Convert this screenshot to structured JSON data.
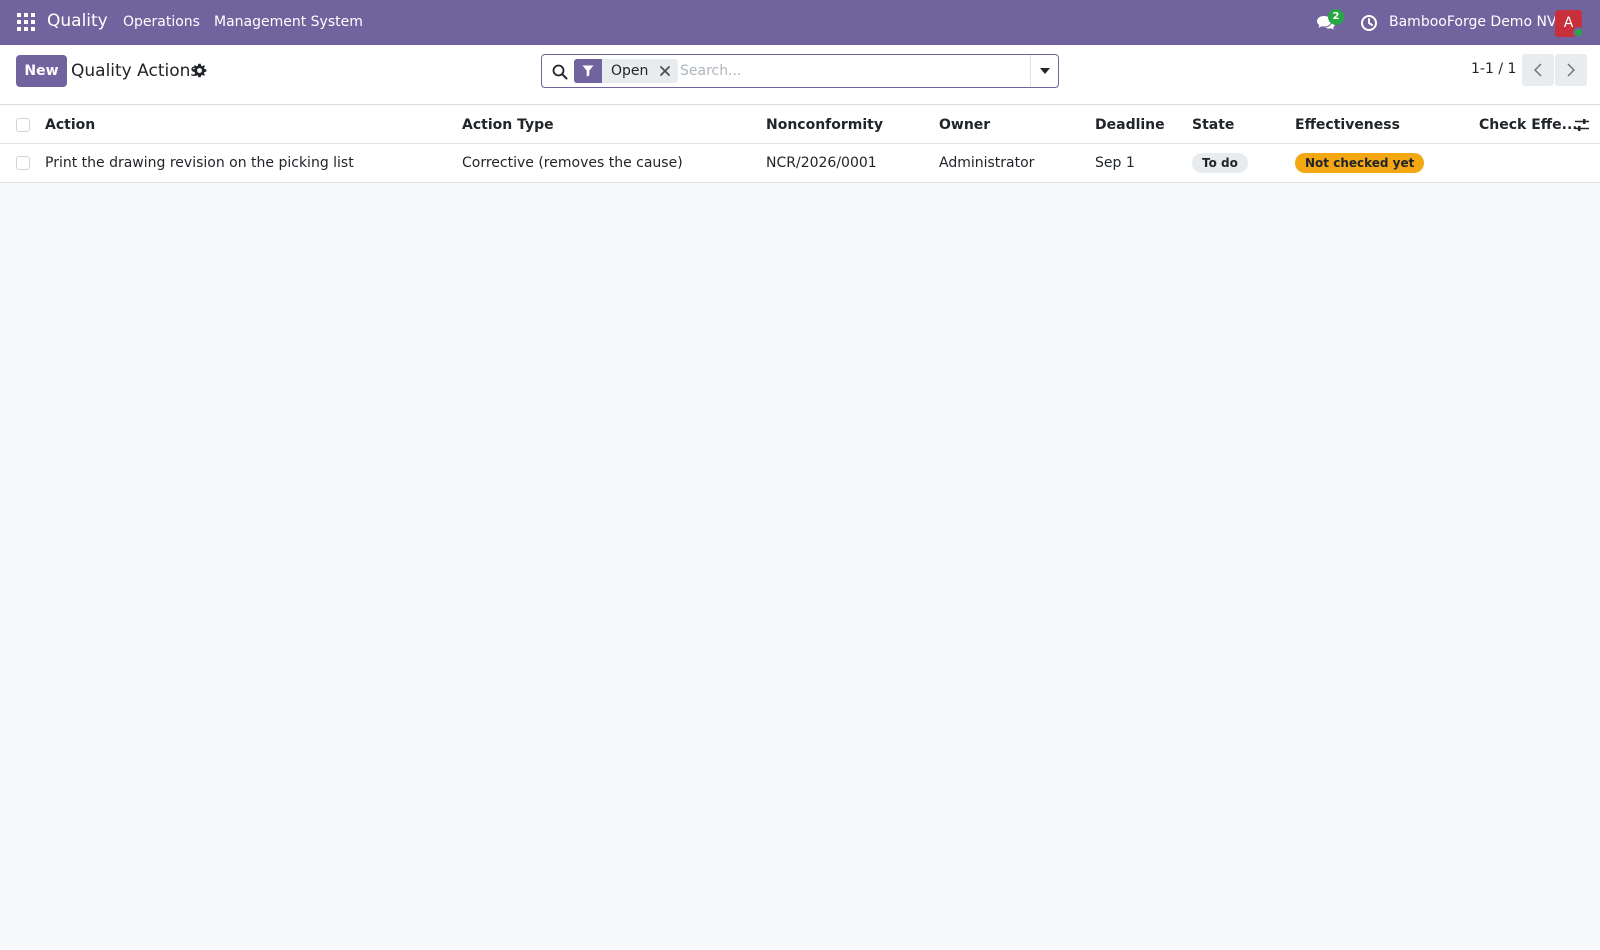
{
  "navbar": {
    "app_name": "Quality",
    "menus": [
      "Operations",
      "Management System"
    ],
    "chat_count": "2",
    "company": "BambooForge Demo NV",
    "avatar_letter": "A",
    "color": "#71639e"
  },
  "control_panel": {
    "new_label": "New",
    "title": "Quality Actions",
    "facet_label": "Open",
    "search_placeholder": "Search...",
    "pager_value": "1-1 / 1"
  },
  "table": {
    "columns": [
      "Action",
      "Action Type",
      "Nonconformity",
      "Owner",
      "Deadline",
      "State",
      "Effectiveness",
      "Check Effe..."
    ],
    "rows": [
      {
        "action": "Print the drawing revision on the picking list",
        "action_type": "Corrective (removes the cause)",
        "nonconformity": "NCR/2026/0001",
        "owner": "Administrator",
        "deadline": "Sep 1",
        "state": "To do",
        "effectiveness": "Not checked yet",
        "check_effectiveness": ""
      }
    ]
  },
  "icons": {
    "apps": "apps-grid-icon",
    "chat": "chat-icon",
    "clock": "clock-icon",
    "gear": "gear-icon",
    "search": "search-icon",
    "filter": "filter-icon",
    "remove": "close-icon",
    "dropdown": "caret-down-icon",
    "prev": "chevron-left-icon",
    "next": "chevron-right-icon",
    "column_settings": "sliders-icon"
  }
}
